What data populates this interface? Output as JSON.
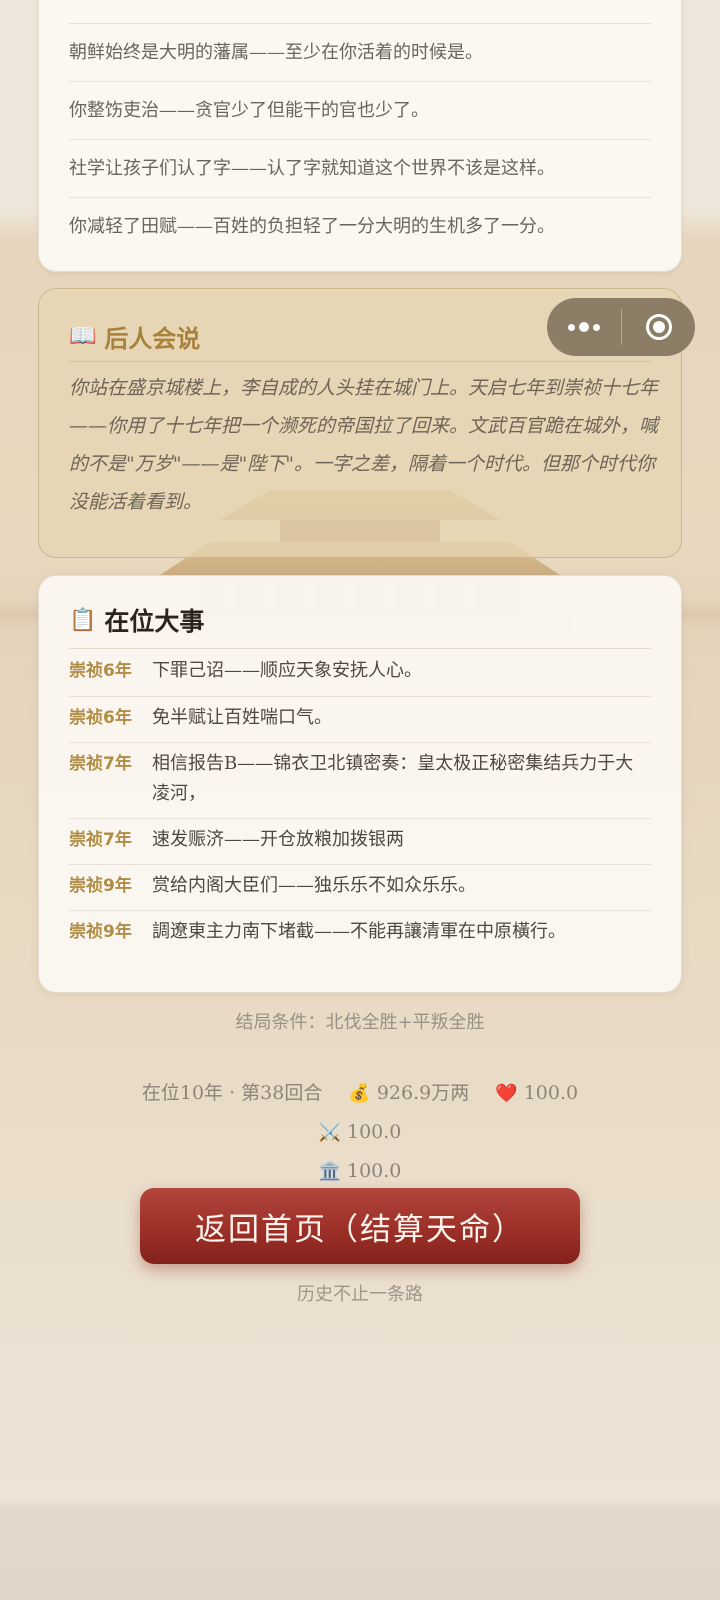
{
  "top_card": {
    "rows": [
      "朝鲜始终是大明的藩属——至少在你活着的时候是。",
      "你整饬吏治——贪官少了但能干的官也少了。",
      "社学让孩子们认了字——认了字就知道这个世界不该是这样。",
      "你减轻了田赋——百姓的负担轻了一分大明的生机多了一分。"
    ]
  },
  "legacy": {
    "icon": "open-book-icon",
    "icon_glyph": "📖",
    "title": "后人会说",
    "text": "你站在盛京城楼上，李自成的人头挂在城门上。天启七年到崇祯十七年——你用了十七年把一个濒死的帝国拉了回来。文武百官跪在城外，喊的不是\"万岁\"——是\"陛下\"。一字之差，隔着一个时代。但那个时代你没能活着看到。"
  },
  "capsule": {
    "more_icon": "more-dots-icon",
    "close_icon": "target-circle-icon"
  },
  "events": {
    "icon": "clipboard-icon",
    "icon_glyph": "📋",
    "title": "在位大事",
    "items": [
      {
        "year": "崇祯6年",
        "text": "下罪己诏——顺应天象安抚人心。"
      },
      {
        "year": "崇祯6年",
        "text": "免半赋让百姓喘口气。"
      },
      {
        "year": "崇祯7年",
        "text": "相信报告B——锦衣卫北镇密奏：皇太极正秘密集结兵力于大凌河，"
      },
      {
        "year": "崇祯7年",
        "text": "速发赈济——开仓放粮加拨银两"
      },
      {
        "year": "崇祯9年",
        "text": "赏给内阁大臣们——独乐乐不如众乐乐。"
      },
      {
        "year": "崇祯9年",
        "text": "調遼東主力南下堵截——不能再讓清軍在中原橫行。"
      }
    ]
  },
  "end_condition": "结局条件：北伐全胜+平叛全胜",
  "stats": {
    "reign": "在位10年 · 第38回合",
    "treasury": {
      "icon": "money-bag-icon",
      "glyph": "💰",
      "value": "926.9万两"
    },
    "heart": {
      "icon": "heart-icon",
      "glyph": "❤️",
      "value": "100.0"
    },
    "military": {
      "icon": "crossed-swords-icon",
      "glyph": "⚔️",
      "value": "100.0"
    },
    "court": {
      "icon": "classical-building-icon",
      "glyph": "🏛️",
      "value": "100.0"
    }
  },
  "home_button": "返回首页（结算天命）",
  "hint": "历史不止一条路",
  "colors": {
    "accent_gold": "#b08c44",
    "button_red": "#9c3028",
    "card_bg": "#fbf8f2"
  }
}
